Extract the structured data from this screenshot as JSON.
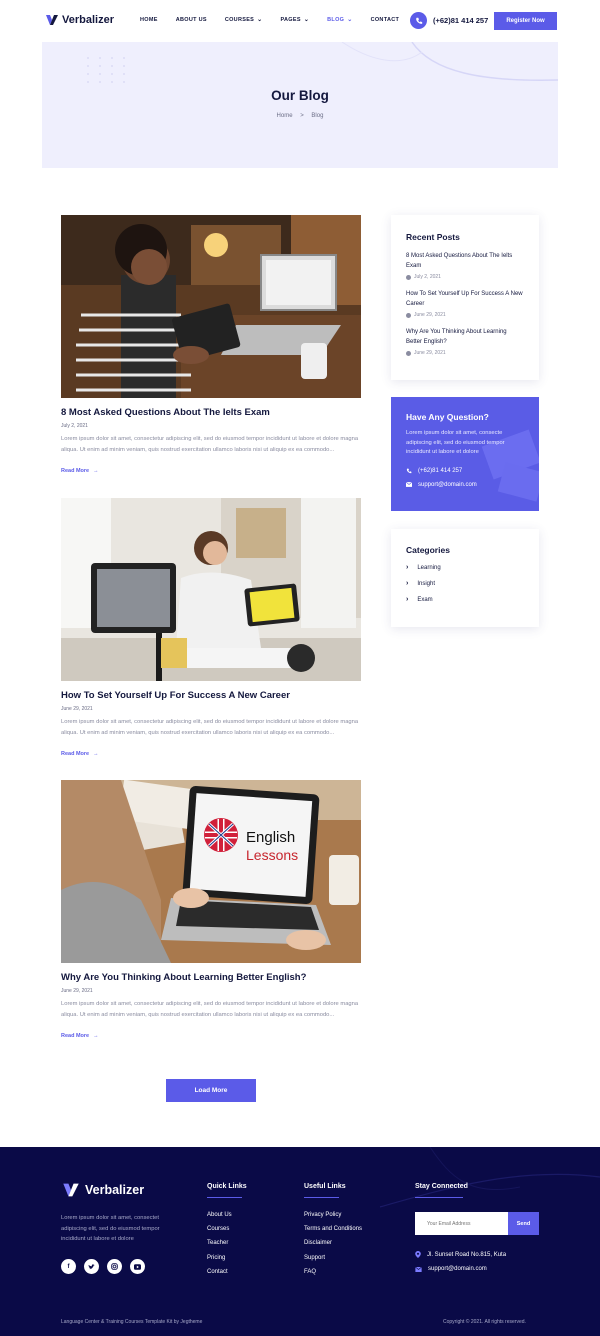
{
  "header": {
    "brand": "Verbalizer",
    "nav": [
      {
        "label": "HOME",
        "dropdown": false,
        "active": false
      },
      {
        "label": "ABOUT US",
        "dropdown": false,
        "active": false
      },
      {
        "label": "COURSES",
        "dropdown": true,
        "active": false
      },
      {
        "label": "PAGES",
        "dropdown": true,
        "active": false
      },
      {
        "label": "BLOG",
        "dropdown": true,
        "active": true
      },
      {
        "label": "CONTACT",
        "dropdown": false,
        "active": false
      }
    ],
    "phone": "(+62)81 414 257",
    "register_label": "Register Now"
  },
  "hero": {
    "title": "Our Blog",
    "breadcrumb_home": "Home",
    "breadcrumb_sep": ">",
    "breadcrumb_current": "Blog"
  },
  "posts": [
    {
      "title": "8 Most Asked Questions About The Ielts Exam",
      "date": "July 2, 2021",
      "excerpt": "Lorem ipsum dolor sit amet, consectetur adipiscing elit, sed do eiusmod tempor incididunt ut labore et dolore magna aliqua. Ut enim ad minim veniam, quis nostrud exercitation ullamco laboris nisi ut aliquip ex ea commodo...",
      "read_more": "Read More"
    },
    {
      "title": "How To Set Yourself Up For Success A New Career",
      "date": "June 29, 2021",
      "excerpt": "Lorem ipsum dolor sit amet, consectetur adipiscing elit, sed do eiusmod tempor incididunt ut labore et dolore magna aliqua. Ut enim ad minim veniam, quis nostrud exercitation ullamco laboris nisi ut aliquip ex ea commodo...",
      "read_more": "Read More"
    },
    {
      "title": "Why Are You Thinking About Learning Better English?",
      "date": "June 29, 2021",
      "excerpt": "Lorem ipsum dolor sit amet, consectetur adipiscing elit, sed do eiusmod tempor incididunt ut labore et dolore magna aliqua. Ut enim ad minim veniam, quis nostrud exercitation ullamco laboris nisi ut aliquip ex ea commodo...",
      "read_more": "Read More",
      "image_text_1": "English",
      "image_text_2": "Lessons"
    }
  ],
  "load_more": "Load More",
  "sidebar": {
    "recent_title": "Recent Posts",
    "recent": [
      {
        "title": "8 Most Asked Questions About The Ielts Exam",
        "date": "July 2, 2021"
      },
      {
        "title": "How To Set Yourself Up For Success A New Career",
        "date": "June 29, 2021"
      },
      {
        "title": "Why Are You Thinking About Learning Better English?",
        "date": "June 29, 2021"
      }
    ],
    "question_title": "Have Any Question?",
    "question_text": "Lorem ipsum dolor sit amet, consecte adipiscing elit, sed do eiusmod tempor incididunt ut labore et dolore",
    "question_phone": "(+62)81 414 257",
    "question_email": "support@domain.com",
    "categories_title": "Categories",
    "categories": [
      "Learning",
      "Insight",
      "Exam"
    ]
  },
  "footer": {
    "brand": "Verbalizer",
    "about": "Lorem ipsum dolor sit amet, consectet adipiscing elit, sed do eiusmod tempor incididunt ut labore et dolore",
    "quick_title": "Quick Links",
    "quick_links": [
      "About Us",
      "Courses",
      "Teacher",
      "Pricing",
      "Contact"
    ],
    "useful_title": "Useful Links",
    "useful_links": [
      "Privacy Policy",
      "Terms and Conditions",
      "Disclaimer",
      "Support",
      "FAQ"
    ],
    "stay_title": "Stay Connected",
    "email_placeholder": "Your Email Address",
    "send_label": "Send",
    "address": "Jl. Sunset Road No.815, Kuta",
    "email": "support@domain.com",
    "copy_left": "Language Center & Training Courses Template Kit by Jegtheme",
    "copy_right": "Copyright © 2021. All rights reserved."
  },
  "colors": {
    "accent": "#5b5be8",
    "navy": "#0a0a47",
    "hero_bg": "#efeffd"
  }
}
